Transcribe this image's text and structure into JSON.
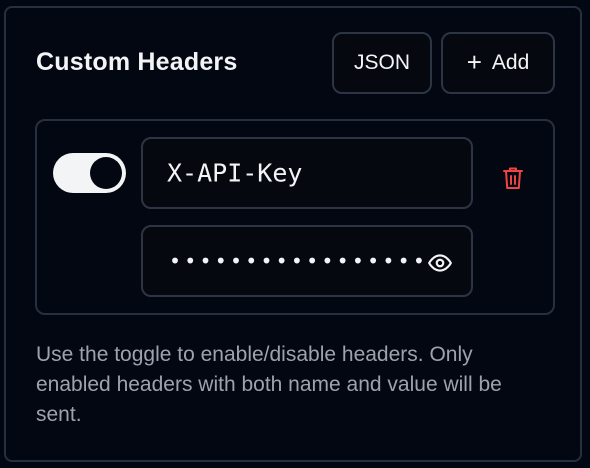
{
  "header": {
    "title": "Custom Headers",
    "json_button": "JSON",
    "add_button": "Add",
    "add_icon": "plus-icon"
  },
  "header_row": {
    "enabled": true,
    "name_value": "X-API-Key",
    "masked_value": "•••••••••••••••••",
    "visibility_icon": "eye-icon",
    "delete_icon": "trash-icon"
  },
  "help_text": "Use the toggle to enable/disable headers. Only enabled headers with both name and value will be sent.",
  "colors": {
    "background": "#030712",
    "border": "#27303f",
    "text": "#f3f4f6",
    "muted_text": "#9ca3af",
    "danger": "#ef4444"
  }
}
